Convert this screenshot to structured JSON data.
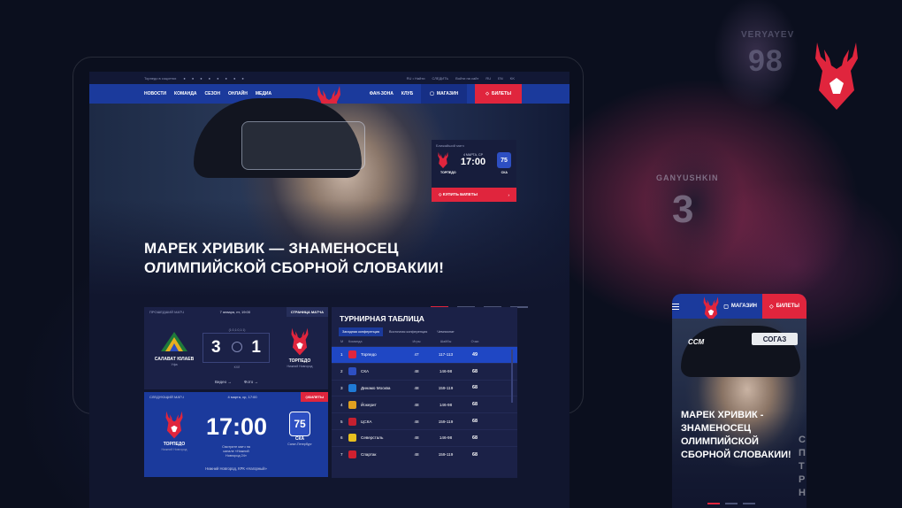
{
  "topbar": {
    "left": "Торпедо в соцсетях",
    "links": [
      "RU • Найти",
      "СЛЕДИТЬ",
      "Войти на сайт",
      "RU",
      "EN",
      "KK"
    ]
  },
  "nav": {
    "items": [
      "НОВОСТИ",
      "КОМАНДА",
      "СЕЗОН",
      "ОНЛАЙН",
      "МЕДИА"
    ],
    "right_items": [
      "ФАН-ЗОНА",
      "КЛУБ"
    ],
    "shop": "МАГАЗИН",
    "tickets": "БИЛЕТЫ"
  },
  "hero": {
    "title_line1": "МАРЕК ХРИВИК — ЗНАМЕНОСЕЦ",
    "title_line2": "ОЛИМПИЙСКОЙ СБОРНОЙ СЛОВАКИИ!",
    "slides": 4,
    "active_slide": 1
  },
  "nearest": {
    "label": "Ближайший матч",
    "date": "4 МАРТА, СР",
    "time": "17:00",
    "home": "ТОРПЕДО",
    "away": "СКА",
    "buy": "КУПИТЬ БИЛЕТЫ"
  },
  "prev_match": {
    "label": "ПРОШЕДШИЙ МАТЧ",
    "date": "7 января, пт, 19:00",
    "page_btn": "СТРАНИЦА МАТЧА",
    "home": "САЛАВАТ ЮЛАЕВ",
    "home_city": "Уфа",
    "home_score": "3",
    "away_score": "1",
    "away": "ТОРПЕДО",
    "away_city": "Нижний Новгород",
    "periods": "(1:0,1:0,1:1)",
    "note": "КХЛ",
    "video": "Видео →",
    "photo": "Фото →"
  },
  "next_match": {
    "label": "СЛЕДУЮЩИЙ МАТЧ",
    "date": "4 марта, ср, 17:00",
    "tickets": "БИЛЕТЫ",
    "time": "17:00",
    "caption": "Смотрите матч на канале «Нижний Новгород 24»",
    "home": "ТОРПЕДО",
    "home_city": "Нижний Новгород",
    "away": "СКА",
    "away_city": "Санкт-Петербург",
    "venue": "Нижний Новгород, КРК «Нагорный»"
  },
  "standings": {
    "title": "ТУРНИРНАЯ ТАБЛИЦА",
    "tabs": [
      "Западная конференция",
      "Восточная конференция",
      "Чемпионат"
    ],
    "columns": [
      "М",
      "Команда",
      "Игры",
      "Шайбы",
      "Очки"
    ],
    "rows": [
      {
        "n": "1",
        "team": "Торпедо",
        "games": "47",
        "goals": "117-113",
        "pts": "49",
        "color": "#e0253d"
      },
      {
        "n": "2",
        "team": "СКА",
        "games": "48",
        "goals": "146-98",
        "pts": "68",
        "color": "#2d4fc2"
      },
      {
        "n": "3",
        "team": "Динамо Москва",
        "games": "48",
        "goals": "159-119",
        "pts": "68",
        "color": "#1f7ad6"
      },
      {
        "n": "4",
        "team": "Йокерит",
        "games": "48",
        "goals": "146-98",
        "pts": "68",
        "color": "#e0a020"
      },
      {
        "n": "5",
        "team": "ЦСКА",
        "games": "48",
        "goals": "159-119",
        "pts": "68",
        "color": "#c42030"
      },
      {
        "n": "6",
        "team": "Северсталь",
        "games": "48",
        "goals": "146-98",
        "pts": "68",
        "color": "#e8c020"
      },
      {
        "n": "7",
        "team": "Спартак",
        "games": "48",
        "goals": "159-119",
        "pts": "68",
        "color": "#d02030"
      }
    ]
  },
  "mobile": {
    "shop": "МАГАЗИН",
    "tickets": "БИЛЕТЫ",
    "brand": "СОГАЗ",
    "ccm": "CCM",
    "title_lines": [
      "МАРЕК ХРИВИК -",
      "ЗНАМЕНОСЕЦ",
      "ОЛИМПИЙСКОЙ",
      "СБОРНОЙ СЛОВАКИИ!"
    ],
    "ghost_lines": [
      "С",
      "П",
      "Т",
      "Р",
      "Н"
    ]
  },
  "players": {
    "p1_name": "VERYAYEV",
    "p1_num": "98",
    "p2_name": "GANYUSHKIN",
    "p2_num": "3"
  },
  "colors": {
    "accent": "#e0253d",
    "brand": "#1b3a9c",
    "bg": "#0b0f1e"
  }
}
